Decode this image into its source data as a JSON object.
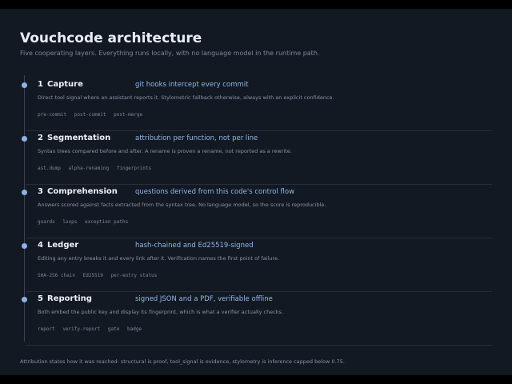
{
  "header": {
    "title": "Vouchcode architecture",
    "subtitle": "Five cooperating layers. Everything runs locally, with no language model in the runtime path."
  },
  "layers": [
    {
      "number": "1",
      "name": "Capture",
      "tagline": "git hooks intercept every commit",
      "description": "Direct tool signal where an assistant reports it. Stylometric fallback otherwise, always with an explicit confidence.",
      "tags": [
        "pre-commit",
        "post-commit",
        "post-merge"
      ]
    },
    {
      "number": "2",
      "name": "Segmentation",
      "tagline": "attribution per function, not per line",
      "description": "Syntax trees compared before and after. A rename is proven a rename, not reported as a rewrite.",
      "tags": [
        "ast.dump",
        "alpha-renaming",
        "fingerprints"
      ]
    },
    {
      "number": "3",
      "name": "Comprehension",
      "tagline": "questions derived from this code's control flow",
      "description": "Answers scored against facts extracted from the syntax tree. No language model, so the score is reproducible.",
      "tags": [
        "guards",
        "loops",
        "exception paths"
      ]
    },
    {
      "number": "4",
      "name": "Ledger",
      "tagline": "hash-chained and Ed25519-signed",
      "description": "Editing any entry breaks it and every link after it. Verification names the first point of failure.",
      "tags": [
        "SHA-256 chain",
        "Ed25519",
        "per-entry status"
      ]
    },
    {
      "number": "5",
      "name": "Reporting",
      "tagline": "signed JSON and a PDF, verifiable offline",
      "description": "Both embed the public key and display its fingerprint, which is what a verifier actually checks.",
      "tags": [
        "report",
        "verify-report",
        "gate",
        "badge"
      ]
    }
  ],
  "footer": {
    "note": "Attribution states how it was reached: structural is proof, tool_signal is evidence, stylometry is inference capped below 0.75."
  },
  "colors": {
    "background": "#131923",
    "accent": "#8fb7e6",
    "dot": "#8ab4e8"
  }
}
